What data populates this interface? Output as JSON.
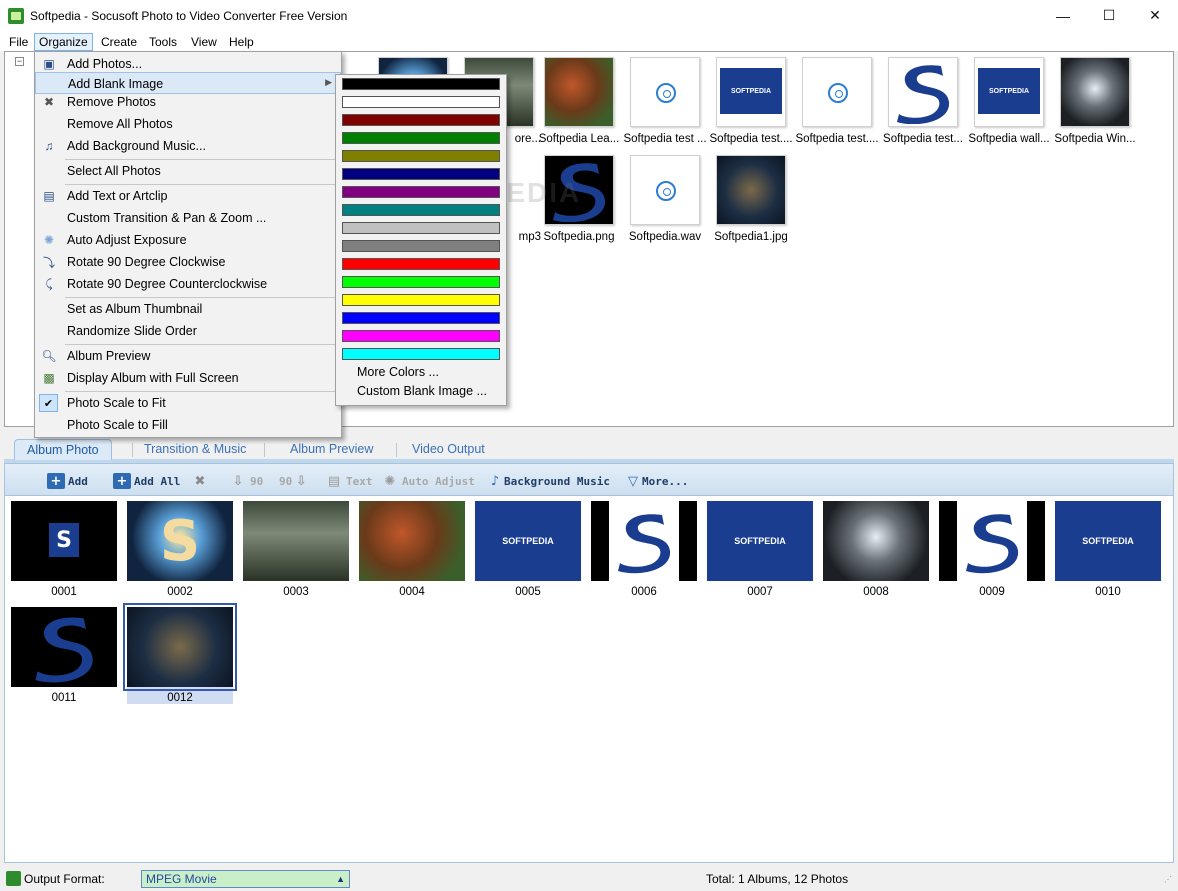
{
  "window": {
    "title": "Softpedia - Socusoft Photo to Video Converter Free Version",
    "minimize": "—",
    "maximize": "☐",
    "close": "✕"
  },
  "menubar": [
    "File",
    "Organize",
    "Create",
    "Tools",
    "View",
    "Help"
  ],
  "organize_menu": {
    "add_photos": "Add Photos...",
    "add_blank_image": "Add Blank Image",
    "remove_photos": "Remove Photos",
    "remove_all_photos": "Remove All Photos",
    "add_background_music": "Add Background Music...",
    "select_all_photos": "Select All Photos",
    "add_text_or_artclip": "Add Text or Artclip",
    "custom_transition": "Custom Transition & Pan & Zoom ...",
    "auto_adjust_exposure": "Auto Adjust Exposure",
    "rotate_cw": "Rotate 90 Degree Clockwise",
    "rotate_ccw": "Rotate 90 Degree Counterclockwise",
    "set_album_thumbnail": "Set as Album Thumbnail",
    "randomize_slide_order": "Randomize Slide Order",
    "album_preview": "Album Preview",
    "display_full_screen": "Display Album with Full Screen",
    "photo_scale_to_fit": "Photo Scale to Fit",
    "photo_scale_to_fill": "Photo Scale to Fill"
  },
  "blank_image_submenu": {
    "colors": [
      "#000000",
      "#ffffff",
      "#800000",
      "#008000",
      "#808000",
      "#000080",
      "#800080",
      "#008080",
      "#c0c0c0",
      "#808080",
      "#ff0000",
      "#00ff00",
      "#ffff00",
      "#0000ff",
      "#ff00ff",
      "#00ffff"
    ],
    "more_colors": "More Colors ...",
    "custom_blank_image": "Custom Blank Image ..."
  },
  "files": {
    "row1": [
      "ore...",
      "Softpedia Lea...",
      "Softpedia test ...",
      "Softpedia test....",
      "Softpedia test....",
      "Softpedia test...",
      "Softpedia wall...",
      "Softpedia Win..."
    ],
    "row2": [
      "mp3",
      "Softpedia.png",
      "Softpedia.wav",
      "Softpedia1.jpg"
    ]
  },
  "watermark": "SOFTPEDIA",
  "thumb_logo_text": "SOFTPEDIA",
  "tabs": [
    "Album Photo",
    "Transition & Music",
    "Album Preview",
    "Video Output"
  ],
  "toolbar": {
    "add": "Add",
    "add_all": "Add All",
    "rotate_ccw": "90",
    "rotate_cw": "90",
    "text": "Text",
    "auto_adjust": "Auto Adjust",
    "background_music": "Background Music",
    "more": "More..."
  },
  "slides": [
    "0001",
    "0002",
    "0003",
    "0004",
    "0005",
    "0006",
    "0007",
    "0008",
    "0009",
    "0010",
    "0011",
    "0012"
  ],
  "status": {
    "output_format_label": "Output Format:",
    "output_format_value": "MPEG Movie",
    "total": "Total: 1 Albums, 12 Photos"
  }
}
